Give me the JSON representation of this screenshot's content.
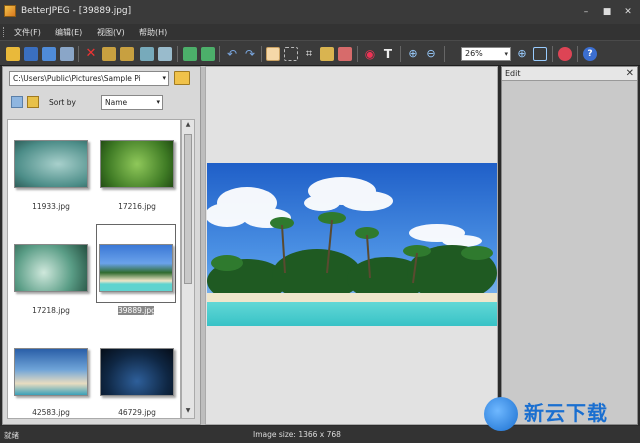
{
  "window": {
    "title": "BetterJPEG - [39889.jpg]",
    "min": "–",
    "max": "■",
    "close": "✕"
  },
  "menu": {
    "items": [
      "文件(F)",
      "编辑(E)",
      "视图(V)",
      "帮助(H)"
    ]
  },
  "toolbar": {
    "zoom_value": "26%",
    "zoom_arrow": "▾"
  },
  "browser": {
    "path": "C:\\Users\\Public\\Pictures\\Sample Pi",
    "sort_label": "Sort by",
    "sort_value": "Name",
    "thumbnails": [
      {
        "label": "11933.jpg"
      },
      {
        "label": "17216.jpg"
      },
      {
        "label": "17218.jpg"
      },
      {
        "label": "39889.jpg"
      },
      {
        "label": "42583.jpg"
      },
      {
        "label": "46729.jpg"
      }
    ]
  },
  "edit_panel": {
    "title": "Edit",
    "close": "✕"
  },
  "status": {
    "left": "就绪",
    "image_size": "Image size: 1366 x 768"
  },
  "watermark": {
    "text": "新云下载"
  },
  "colors": {
    "accent": "#1a6fd0",
    "dark_chrome": "#3a3a3a"
  }
}
